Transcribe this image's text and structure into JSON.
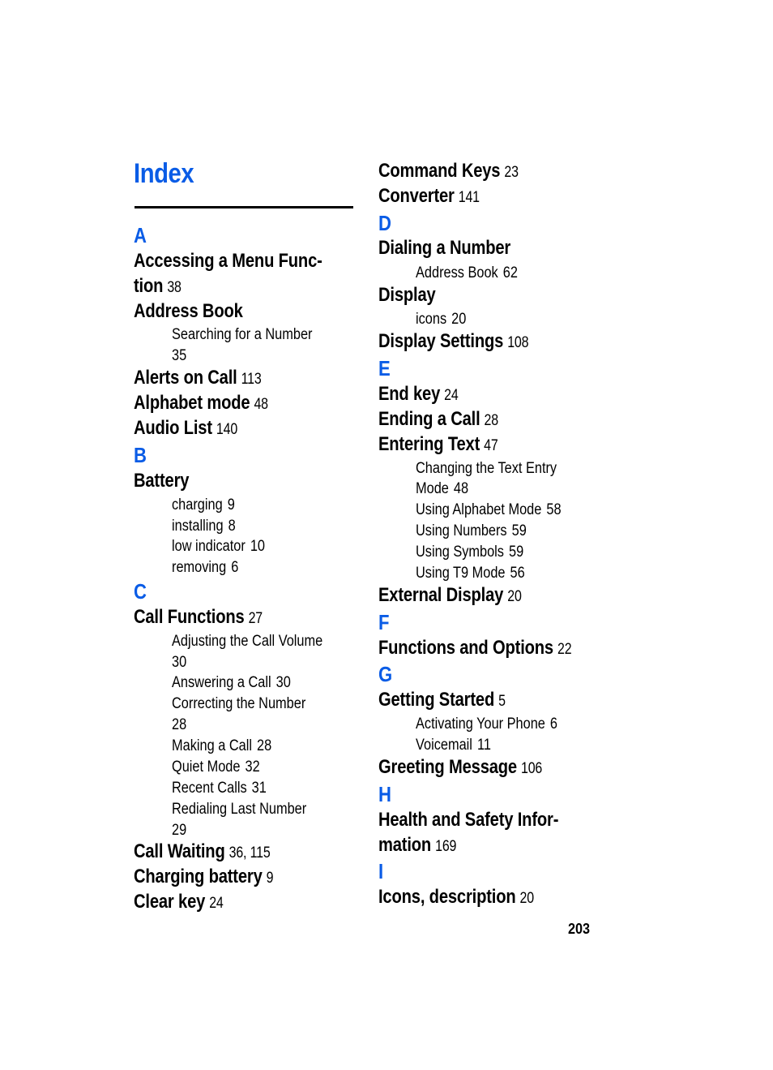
{
  "page": {
    "title": "Index",
    "page_number": "203",
    "accent_color": "#0a5ce6"
  },
  "col1": {
    "letter_a": "A",
    "accessing_1": "Accessing a Menu Func-",
    "accessing_2": "tion",
    "accessing_pg": "38",
    "address_book": "Address Book",
    "address_book_sub1_1": "Searching for a Number",
    "address_book_sub1_2": "35",
    "alerts": "Alerts on Call",
    "alerts_pg": "113",
    "alphabet": "Alphabet mode",
    "alphabet_pg": "48",
    "audio": "Audio List",
    "audio_pg": "140",
    "letter_b": "B",
    "battery": "Battery",
    "battery_subs": [
      {
        "label": "charging",
        "page": "9"
      },
      {
        "label": "installing",
        "page": "8"
      },
      {
        "label": "low indicator",
        "page": "10"
      },
      {
        "label": "removing",
        "page": "6"
      }
    ],
    "letter_c": "C",
    "call_functions": "Call Functions",
    "call_functions_pg": "27",
    "cf_adjusting_1": "Adjusting the Call Volume",
    "cf_adjusting_2": "30",
    "cf_answering": "Answering a Call",
    "cf_answering_pg": "30",
    "cf_correcting_1": "Correcting the Number",
    "cf_correcting_2": "28",
    "cf_making": "Making a Call",
    "cf_making_pg": "28",
    "cf_quiet": "Quiet Mode",
    "cf_quiet_pg": "32",
    "cf_recent": "Recent Calls",
    "cf_recent_pg": "31",
    "cf_redialing_1": "Redialing Last Number",
    "cf_redialing_2": "29",
    "call_waiting": "Call Waiting",
    "call_waiting_pg": "36, 115",
    "charging_battery": "Charging battery",
    "charging_battery_pg": "9",
    "clear_key": "Clear key",
    "clear_key_pg": "24"
  },
  "col2": {
    "command_keys": "Command Keys",
    "command_keys_pg": "23",
    "converter": "Converter",
    "converter_pg": "141",
    "letter_d": "D",
    "dialing": "Dialing a Number",
    "dialing_sub": "Address Book",
    "dialing_sub_pg": "62",
    "display": "Display",
    "display_sub": "icons",
    "display_sub_pg": "20",
    "display_settings": "Display Settings",
    "display_settings_pg": "108",
    "letter_e": "E",
    "end_key": "End key",
    "end_key_pg": "24",
    "ending_call": "Ending a Call",
    "ending_call_pg": "28",
    "entering_text": "Entering Text",
    "entering_text_pg": "47",
    "et_changing_1": "Changing the Text Entry",
    "et_changing_2": "Mode",
    "et_changing_pg": "48",
    "et_alphabet": "Using Alphabet Mode",
    "et_alphabet_pg": "58",
    "et_numbers": "Using Numbers",
    "et_numbers_pg": "59",
    "et_symbols": "Using Symbols",
    "et_symbols_pg": "59",
    "et_t9": "Using T9 Mode",
    "et_t9_pg": "56",
    "external_display": "External Display",
    "external_display_pg": "20",
    "letter_f": "F",
    "functions_options": "Functions and Options",
    "functions_options_pg": "22",
    "letter_g": "G",
    "getting_started": "Getting Started",
    "getting_started_pg": "5",
    "gs_activating": "Activating Your Phone",
    "gs_activating_pg": "6",
    "gs_voicemail": "Voicemail",
    "gs_voicemail_pg": "11",
    "greeting": "Greeting Message",
    "greeting_pg": "106",
    "letter_h": "H",
    "health_1": "Health and Safety Infor-",
    "health_2": "mation",
    "health_pg": "169",
    "letter_i": "I",
    "icons": "Icons, description",
    "icons_pg": "20"
  }
}
